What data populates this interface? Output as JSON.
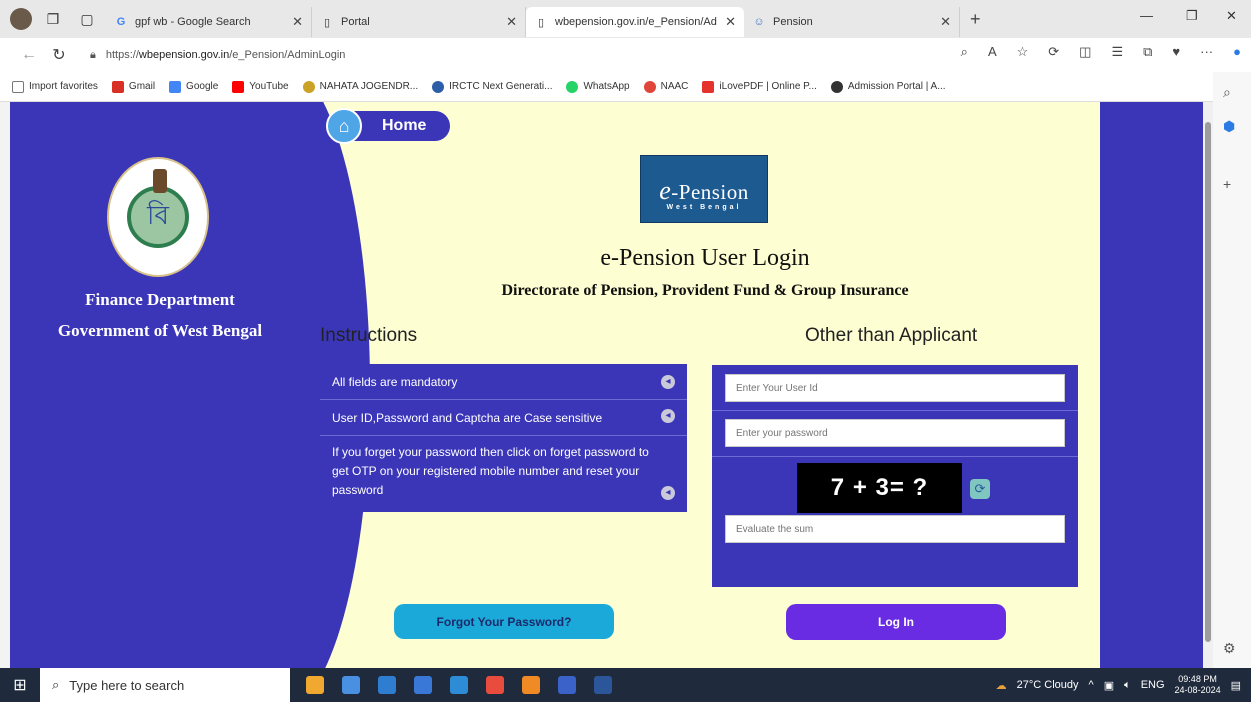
{
  "browser": {
    "tabs": [
      {
        "title": "gpf wb - Google Search",
        "favicon": "G",
        "favicon_color": "#4285f4"
      },
      {
        "title": "Portal",
        "favicon": "▯",
        "favicon_color": "#444444"
      },
      {
        "title": "wbepension.gov.in/e_Pension/Ad",
        "favicon": "▯",
        "favicon_color": "#444444"
      },
      {
        "title": "Pension",
        "favicon": "☺",
        "favicon_color": "#3b75c0"
      }
    ],
    "new_tab": "+",
    "url_prefix": "https://",
    "url_host": "wbepension.gov.in",
    "url_path": "/e_Pension/AdminLogin",
    "bookmarks": [
      {
        "label": "Import favorites",
        "color": "#777777"
      },
      {
        "label": "Gmail",
        "color": "#d93025"
      },
      {
        "label": "Google",
        "color": "#4285f4"
      },
      {
        "label": "YouTube",
        "color": "#ff0000"
      },
      {
        "label": "NAHATA JOGENDR...",
        "color": "#c9a227"
      },
      {
        "label": "IRCTC Next Generati...",
        "color": "#2d5fa8"
      },
      {
        "label": "WhatsApp",
        "color": "#25d366"
      },
      {
        "label": "NAAC",
        "color": "#e0453a"
      },
      {
        "label": "iLovePDF | Online P...",
        "color": "#e5322d"
      },
      {
        "label": "Admission Portal | A...",
        "color": "#333333"
      }
    ]
  },
  "page": {
    "home_label": "Home",
    "dept_line1": "Finance Department",
    "dept_line2": "Government of West Bengal",
    "logo_e": "e",
    "logo_title": "-Pension",
    "logo_subtitle": "West Bengal",
    "login_title": "e-Pension User Login",
    "login_subtitle": "Directorate of Pension, Provident Fund & Group Insurance",
    "instructions_heading": "Instructions",
    "instructions": [
      "All fields are mandatory",
      "User ID,Password and Captcha are Case sensitive",
      "If you forget your password then click on forget password to get OTP on your registered mobile number and reset your password"
    ],
    "other_heading": "Other than Applicant",
    "userid_placeholder": "Enter Your User Id",
    "password_placeholder": "Enter your password",
    "captcha_text": "7 + 3= ?",
    "sum_placeholder": "Evaluate the sum",
    "forgot_label": "Forgot Your Password?",
    "login_label": "Log In"
  },
  "taskbar": {
    "search_placeholder": "Type here to search",
    "weather": "27°C  Cloudy",
    "lang": "ENG",
    "time": "09:48 PM",
    "date": "24-08-2024",
    "apps": [
      "#f0a830",
      "#4a90e2",
      "#2f7dd1",
      "#3a78d8",
      "#2e8bd6",
      "#e74c3c",
      "#f08a24",
      "#3b62c9",
      "#2b579a"
    ]
  },
  "colors": {
    "panel_blue": "#3b36b8",
    "page_bg": "#fdfed2"
  }
}
